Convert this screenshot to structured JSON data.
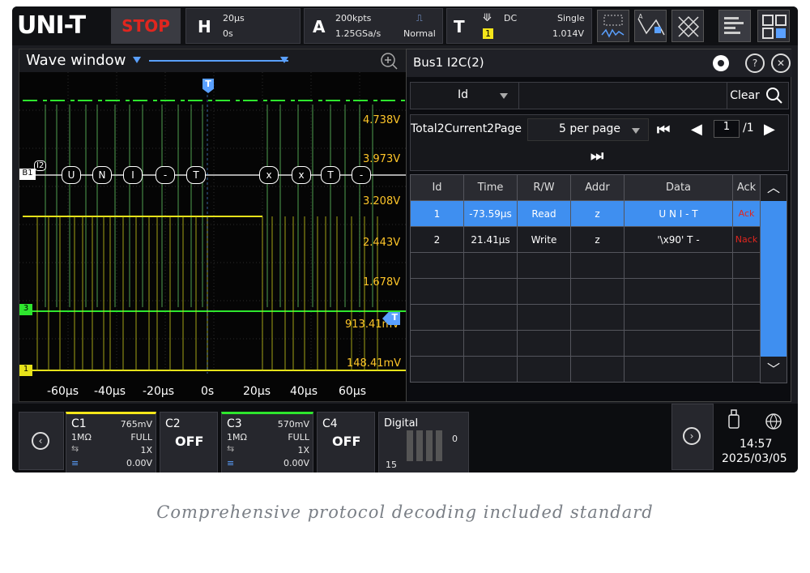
{
  "topbar": {
    "brand": "UNI-T",
    "run_state": "STOP",
    "horizontal": {
      "letter": "H",
      "timebase": "20µs",
      "position": "0s"
    },
    "acquire": {
      "letter": "A",
      "memory": "200kpts",
      "sample_rate": "1.25GSa/s",
      "mode": "Normal"
    },
    "trigger": {
      "letter": "T",
      "coupling": "DC",
      "source": "1",
      "sweep": "Single",
      "level": "1.014V"
    }
  },
  "wave_window": {
    "title": "Wave window",
    "voltage_labels": [
      "4.738V",
      "3.973V",
      "3.208V",
      "2.443V",
      "1.678V",
      "913.41mV",
      "148.41mV"
    ],
    "time_ticks": [
      "-60µs",
      "-40µs",
      "-20µs",
      "0s",
      "20µs",
      "40µs",
      "60µs"
    ],
    "bus_label": "B1",
    "bus_tag": "I2",
    "bus_frames": [
      "U",
      "N",
      "I",
      "-",
      "T",
      "x",
      "x",
      "T",
      "-"
    ],
    "ch3_marker": "3",
    "ch1_marker": "1",
    "trigger_marker": "T"
  },
  "decode": {
    "title": "Bus1 I2C(2)",
    "filter_field": "Id",
    "clear_label": "Clear",
    "total_text": "Total2Current2Page",
    "per_page": "5 per page",
    "page_current": "1",
    "page_total": "/1",
    "columns": [
      "Id",
      "Time",
      "R/W",
      "Addr",
      "Data",
      "Ack"
    ],
    "rows": [
      {
        "id": "1",
        "time": "-73.59µs",
        "rw": "Read",
        "addr": "z",
        "data": "U N I - T",
        "ack": "Ack"
      },
      {
        "id": "2",
        "time": "21.41µs",
        "rw": "Write",
        "addr": "z",
        "data": "'\\x90' T -",
        "ack": "Nack"
      }
    ]
  },
  "channels": {
    "c1": {
      "name": "C1",
      "scale": "765mV",
      "impedance": "1MΩ",
      "bandwidth": "FULL",
      "probe": "1X",
      "offset": "0.00V",
      "color": "#f5e61a"
    },
    "c2": {
      "name": "C2",
      "state": "OFF"
    },
    "c3": {
      "name": "C3",
      "scale": "570mV",
      "impedance": "1MΩ",
      "bandwidth": "FULL",
      "probe": "1X",
      "offset": "0.00V",
      "color": "#2ee62e"
    },
    "c4": {
      "name": "C4",
      "state": "OFF"
    },
    "digital": {
      "name": "Digital",
      "low": "0",
      "high": "15"
    }
  },
  "status": {
    "time": "14:57",
    "date": "2025/03/05"
  },
  "caption": "Comprehensive protocol decoding included standard"
}
